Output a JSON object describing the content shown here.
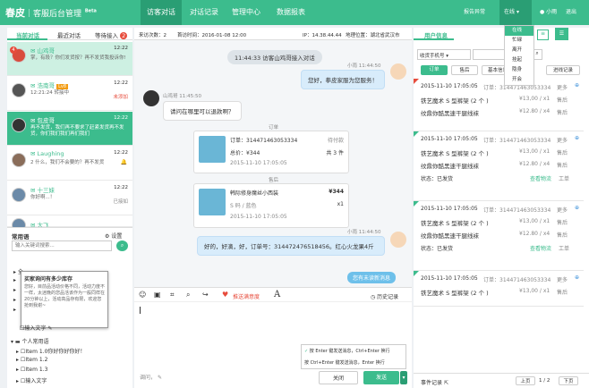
{
  "brand": {
    "name": "春皮",
    "sub": "客服后台管理",
    "beta": "Beta"
  },
  "nav": [
    "访客对话",
    "对话记录",
    "管理中心",
    "数据报表"
  ],
  "topright": {
    "report": "报告异常",
    "online": "在线",
    "user": "小雨",
    "logout": "退出"
  },
  "status_menu": [
    "在线",
    "忙碌",
    "离开",
    "挂起",
    "隐身",
    "开会"
  ],
  "left_tabs": [
    "当前对话",
    "最近对话",
    "等待接入",
    "2"
  ],
  "conversations": [
    {
      "name": "山鸡哥",
      "badge": "4",
      "time": "12:22",
      "msg": "掌，有段？你们发货按？再不发货我投诉你!",
      "color": "#c7372f"
    },
    {
      "name": "浩南哥",
      "vip": "Lv8",
      "time": "12:22",
      "msg": "12:21:24 转接中",
      "status": "未添加"
    },
    {
      "name": "包皮哥",
      "time": "12:22",
      "msg": "再不发货，我们再不要求了赶紧发货再不发货，你们我们我们再们我们"
    },
    {
      "name": "Laughing",
      "time": "12:22",
      "msg": "2 什么，我们不会要的？再不发货"
    },
    {
      "name": "十三妹",
      "time": "12:22",
      "msg": "你好啊...！",
      "status": "已接如"
    },
    {
      "name": "大飞",
      "time": "12:22",
      "msg": ""
    }
  ],
  "faq": {
    "title": "常用语",
    "settings": "设置",
    "search_placeholder": "输入关键词搜索...",
    "tooltip_title": "买家询问有多少库存",
    "tooltip_body": "您好，目前品活动价格不同，活动力度不一样，太迷晚的您品活该作为一般同样在20分钟以上，活动高品存有限，欢迎您抢到我谢~",
    "items_a": [
      "全",
      "",
      "",
      "",
      "输入文字"
    ],
    "group2": "个人常用语",
    "items_b": [
      "Item 1.0你好你好你好！",
      "Item 1.2",
      "Item 1.3",
      "输入文字"
    ]
  },
  "chat": {
    "count_label": "来访次数：2",
    "start_time": "首访时间：2016-01-08 12:00",
    "ip": "IP：14.38.44.44",
    "location": "地理位置：湖北省武汉市",
    "banner": "11:44:33 访客山鸡哥接入对话",
    "agent_name": "小雨",
    "agent_time": "11:44:50",
    "greet": "您好，拳皮家服为您服务！",
    "visitor_name": "山鸡哥",
    "visitor_time": "11:45:50",
    "visitor_msg": "请问在哪里可以退款啊？",
    "order_label": "订单",
    "refund_label": "售后",
    "reply": "好的，好滴，好，订单号：314472476518456。红心火龙果4斤",
    "history_more": "您有未读新消息"
  },
  "order_card1": {
    "no": "订单：314471463053334",
    "status": "待付款",
    "total": "总价：¥344",
    "count": "共 3 件",
    "date": "2015-11-10 17:05:05"
  },
  "order_card2": {
    "title": "韩际修身魔丝小西装",
    "price": "¥344",
    "spec": "S 码 / 蓝色",
    "qty": "x1",
    "date": "2015-11-10 17:05:05"
  },
  "toolbar": {
    "emotion": "推送满意度",
    "history": "历史记录"
  },
  "send_opts": [
    "按 Enter 键发送消息，Ctrl+Enter 换行",
    "按 Ctrl+Enter 键发送消息，Enter 换行"
  ],
  "input_placeholder": "调问，",
  "buttons": {
    "close": "关闭",
    "send": "发送"
  },
  "rpanel": {
    "title": "用户信息",
    "search_placeholder": "收货手机号",
    "tabs": [
      "订单",
      "售后",
      "基本信息",
      "资料",
      "进线记录"
    ],
    "footer": "事件记录",
    "prev": "上页",
    "page": "1 / 2",
    "next": "下页"
  },
  "orders": [
    {
      "date": "2015-11-10 17:05:05",
      "no": "订单：314471463053334",
      "more": "更多",
      "item1": "铁艺魔术 S 型裤架 (2 个 )",
      "p1": "¥13,00 / x1",
      "s1": "售后",
      "item2": "纹鼎你酷黑速干腿线袜",
      "p2": "¥12.80 / x4",
      "s2": "售后"
    },
    {
      "date": "2015-11-10 17:05:05",
      "no": "订单：314471463053334",
      "more": "更多",
      "item1": "铁艺魔术 S 型裤架 (2 个 )",
      "p1": "¥13,00 / x1",
      "s1": "售后",
      "item2": "纹鼎你酷黑速干腿线袜",
      "p2": "¥12.80 / x4",
      "s2": "售后",
      "state": "状态：已发货",
      "logistics": "查看物流",
      "wo": "工单"
    },
    {
      "date": "2015-11-10 17:05:05",
      "no": "订单：314471463053334",
      "more": "更多",
      "item1": "铁艺魔术 S 型裤架 (2 个 )",
      "p1": "¥13,00 / x1",
      "s1": "售后",
      "item2": "纹鼎你酷黑速干腿线袜",
      "p2": "¥12.80 / x4",
      "s2": "售后",
      "state": "状态：已发货",
      "logistics": "查看物流",
      "wo": "工单"
    },
    {
      "date": "2015-11-10 17:05:05",
      "no": "订单：314471463053334",
      "more": "更多",
      "item1": "铁艺魔术 S 型裤架 (2 个 )",
      "p1": "¥13,00 / x1",
      "s1": "售后"
    }
  ]
}
